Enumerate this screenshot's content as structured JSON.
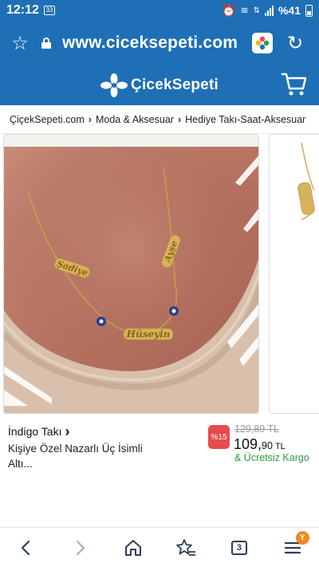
{
  "status_bar": {
    "time": "12:12",
    "notification": "33",
    "battery": "%41"
  },
  "browser": {
    "url": "www.ciceksepeti.com"
  },
  "site": {
    "logo_text": "ÇicekSepeti"
  },
  "breadcrumb": [
    "ÇiçekSepeti.com",
    "Moda & Aksesuar",
    "Hediye Takı-Saat-Aksesuar"
  ],
  "product": {
    "brand": "İndigo Takı",
    "name_line1": "Kişiye Özel Nazarlı Üç İsimli",
    "name_line2": "Altı...",
    "discount": "%15",
    "old_price": "129,89 TL",
    "price_main": "109,",
    "price_decimal": "90",
    "currency": "TL",
    "shipping": "& Ücretsiz Kargo",
    "engravings": [
      "Şadiye",
      "Hüseyin",
      "Ayşe"
    ]
  },
  "bottom_nav": {
    "tabs_count": "3",
    "menu_badge": "Y"
  },
  "colors": {
    "brand_blue": "#1e6fb5",
    "discount_red": "#e84b4b",
    "shipping_green": "#2e9a3e",
    "badge_orange": "#ef8a1e"
  },
  "icons": [
    "star-icon",
    "lock-icon",
    "site-favicon-icon",
    "reload-icon",
    "cart-icon",
    "chevron-right-icon",
    "back-icon",
    "forward-icon",
    "home-icon",
    "bookmarks-icon",
    "tabs-icon",
    "menu-icon"
  ]
}
